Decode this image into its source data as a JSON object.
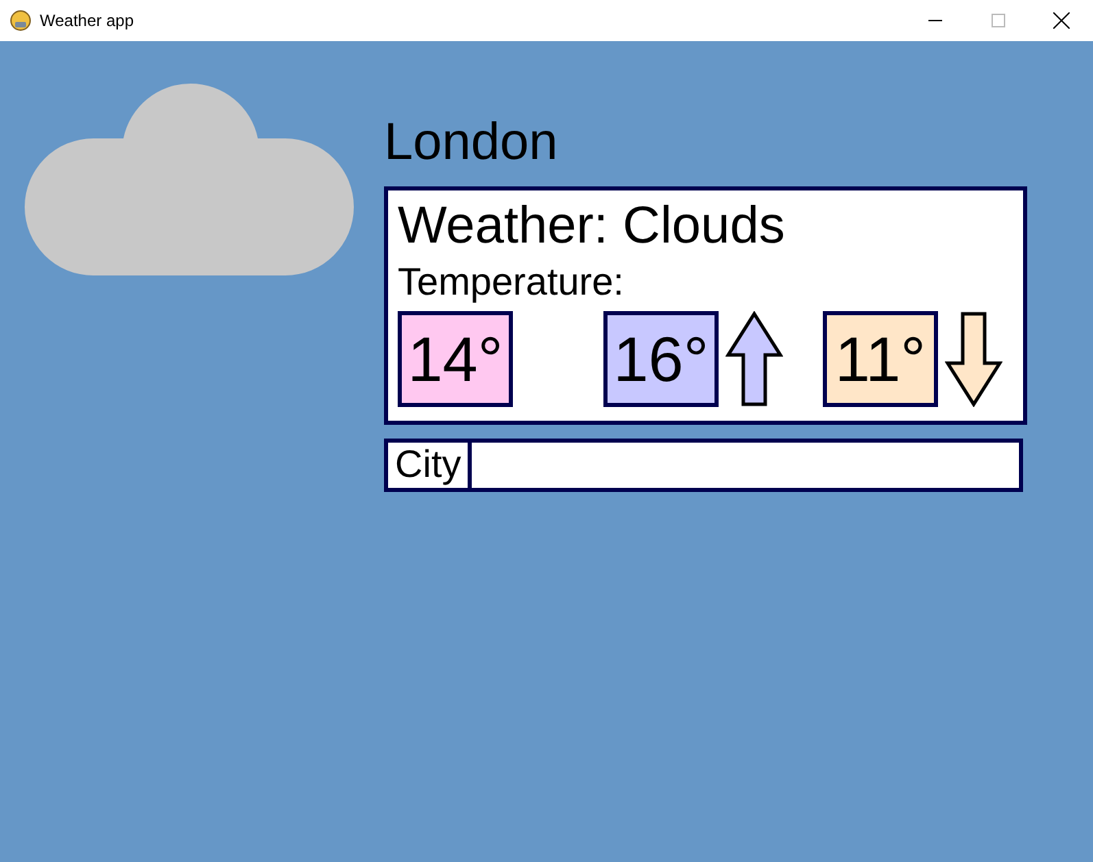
{
  "window": {
    "title": "Weather app"
  },
  "city": "London",
  "weather": {
    "label": "Weather: Clouds",
    "temperature_label": "Temperature:",
    "temperatures": [
      {
        "kind": "current",
        "value": "14°",
        "color": "#ffc8f0"
      },
      {
        "kind": "high",
        "value": "16°",
        "color": "#c8c8ff"
      },
      {
        "kind": "low",
        "value": "11°",
        "color": "#ffe6c8"
      }
    ]
  },
  "search": {
    "label": "City"
  }
}
